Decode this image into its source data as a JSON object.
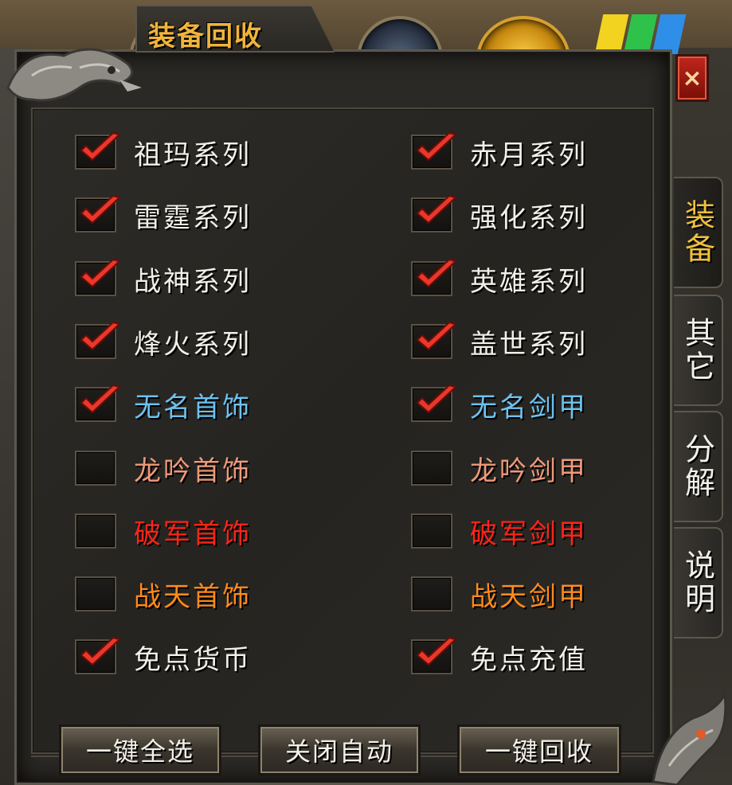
{
  "window": {
    "title": "装备回收",
    "close_label": "×"
  },
  "side_tabs": [
    {
      "label": "装备",
      "active": true
    },
    {
      "label": "其它",
      "active": false
    },
    {
      "label": "分解",
      "active": false
    },
    {
      "label": "说明",
      "active": false
    }
  ],
  "options": [
    {
      "label": "祖玛系列",
      "checked": true,
      "color": "#f2efe8"
    },
    {
      "label": "赤月系列",
      "checked": true,
      "color": "#f2efe8"
    },
    {
      "label": "雷霆系列",
      "checked": true,
      "color": "#f2efe8"
    },
    {
      "label": "强化系列",
      "checked": true,
      "color": "#f2efe8"
    },
    {
      "label": "战神系列",
      "checked": true,
      "color": "#f2efe8"
    },
    {
      "label": "英雄系列",
      "checked": true,
      "color": "#f2efe8"
    },
    {
      "label": "烽火系列",
      "checked": true,
      "color": "#f2efe8"
    },
    {
      "label": "盖世系列",
      "checked": true,
      "color": "#f2efe8"
    },
    {
      "label": "无名首饰",
      "checked": true,
      "color": "#6cc2f0"
    },
    {
      "label": "无名剑甲",
      "checked": true,
      "color": "#6cc2f0"
    },
    {
      "label": "龙吟首饰",
      "checked": false,
      "color": "#ee9a7a"
    },
    {
      "label": "龙吟剑甲",
      "checked": false,
      "color": "#ee9a7a"
    },
    {
      "label": "破军首饰",
      "checked": false,
      "color": "#ff2418"
    },
    {
      "label": "破军剑甲",
      "checked": false,
      "color": "#ff2418"
    },
    {
      "label": "战天首饰",
      "checked": false,
      "color": "#ff8a1c"
    },
    {
      "label": "战天剑甲",
      "checked": false,
      "color": "#ff8a1c"
    },
    {
      "label": "免点货币",
      "checked": true,
      "color": "#f2efe8"
    },
    {
      "label": "免点充值",
      "checked": true,
      "color": "#f2efe8"
    }
  ],
  "buttons": {
    "select_all": "一键全选",
    "close_auto": "关闭自动",
    "recycle_all": "一键回收"
  },
  "icons": {
    "checkmark": "checkmark-icon",
    "close": "close-icon",
    "dragon": "dragon-ornament-icon"
  },
  "colors": {
    "title": "#f0b43c",
    "checkmark": "#e8382c",
    "panel": "#2b2925"
  }
}
